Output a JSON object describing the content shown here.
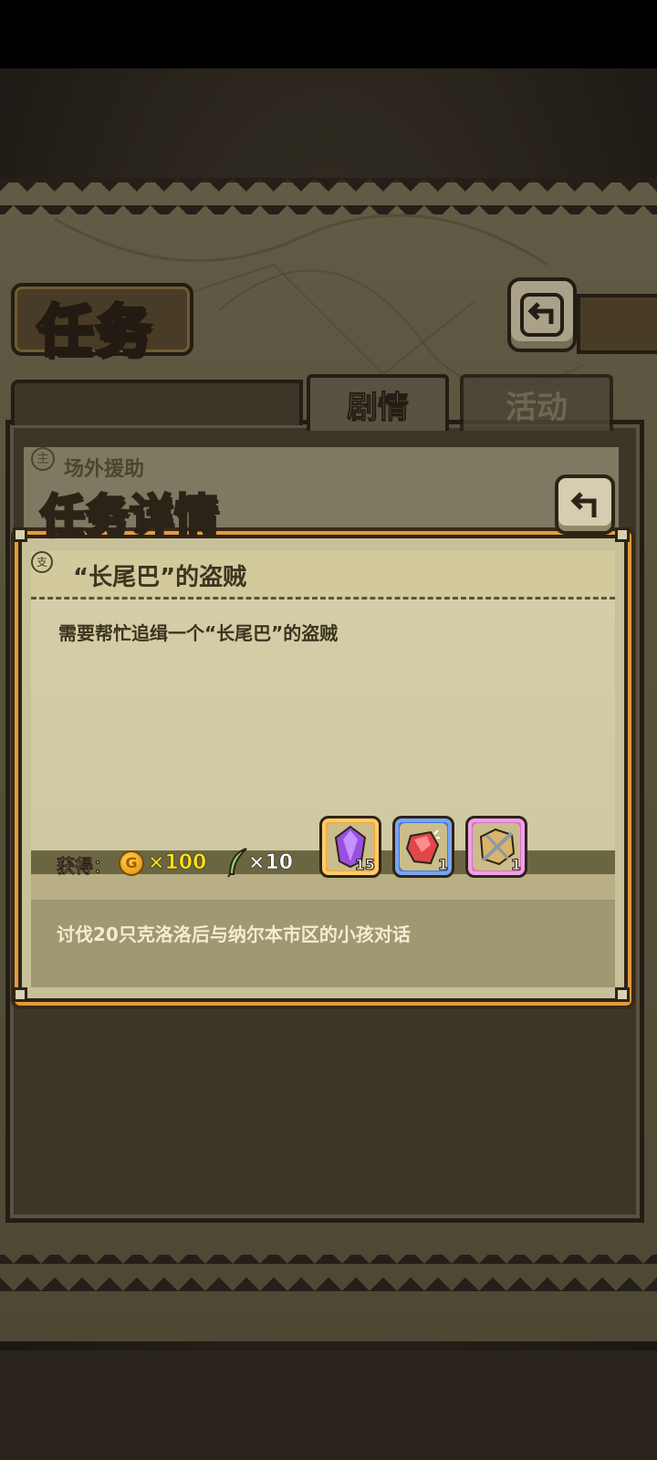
{
  "screen": {
    "title": "任务",
    "tabs": [
      {
        "label": "剧情",
        "active": true
      },
      {
        "label": "活动",
        "active": false
      }
    ],
    "list_item_label": "场外援助"
  },
  "modal": {
    "heading": "任务详情",
    "quest_title": "“长尾巴”的盗贼",
    "description": "需要帮忙追缉一个“长尾巴”的盗贼",
    "reward_label": "获得：",
    "gold_symbol": "G",
    "gold_amount": "×100",
    "feather_amount": "×10",
    "items": [
      {
        "name": "purple-crystal",
        "count": "15",
        "frame": "#f2a53a"
      },
      {
        "name": "red-ore",
        "count": "1",
        "frame": "#4a78d8"
      },
      {
        "name": "wrapped-weapon",
        "count": "1",
        "frame": "#d870c8"
      }
    ],
    "objective": "讨伐20只克洛洛后与纳尔本市区的小孩对话"
  }
}
